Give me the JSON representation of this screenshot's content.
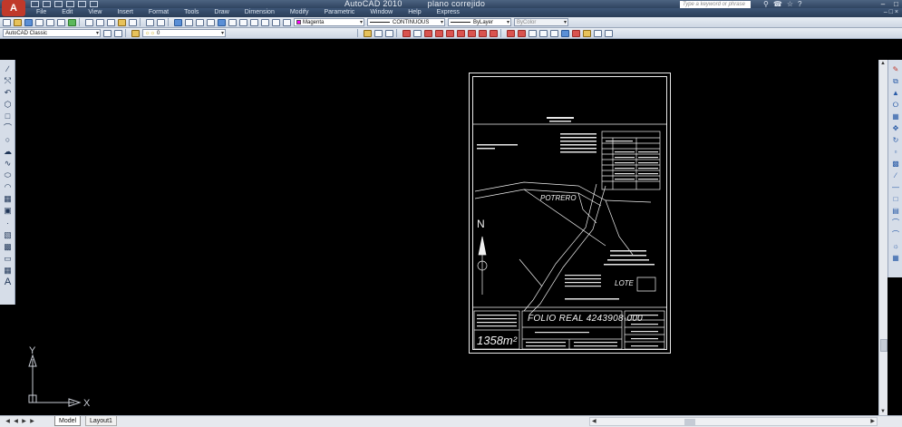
{
  "title_bar": {
    "app_name": "AutoCAD 2010",
    "file_name": "plano correjido",
    "search_placeholder": "Type a keyword or phrase"
  },
  "menu": [
    "File",
    "Edit",
    "View",
    "Insert",
    "Format",
    "Tools",
    "Draw",
    "Dimension",
    "Modify",
    "Parametric",
    "Window",
    "Help",
    "Express"
  ],
  "toolbar": {
    "color_value": "Magenta",
    "linetype_value": "CONTINUOUS",
    "lineweight_value": "ByLayer",
    "plotstyle_value": "ByColor",
    "workspace_value": "AutoCAD Classic",
    "layer_value": "0"
  },
  "ucs": {
    "x_label": "X",
    "y_label": "Y"
  },
  "layout_tabs": {
    "model": "Model",
    "layout1": "Layout1"
  },
  "drawing": {
    "text_potrero": "POTRERO",
    "text_north": "N",
    "text_lote": "LOTE",
    "text_folio": "FOLIO REAL 4243908-000",
    "text_area": "1358m²"
  },
  "colors": {
    "accent": "#ff00ff",
    "canvas": "#000000",
    "lines": "#ffffff"
  }
}
